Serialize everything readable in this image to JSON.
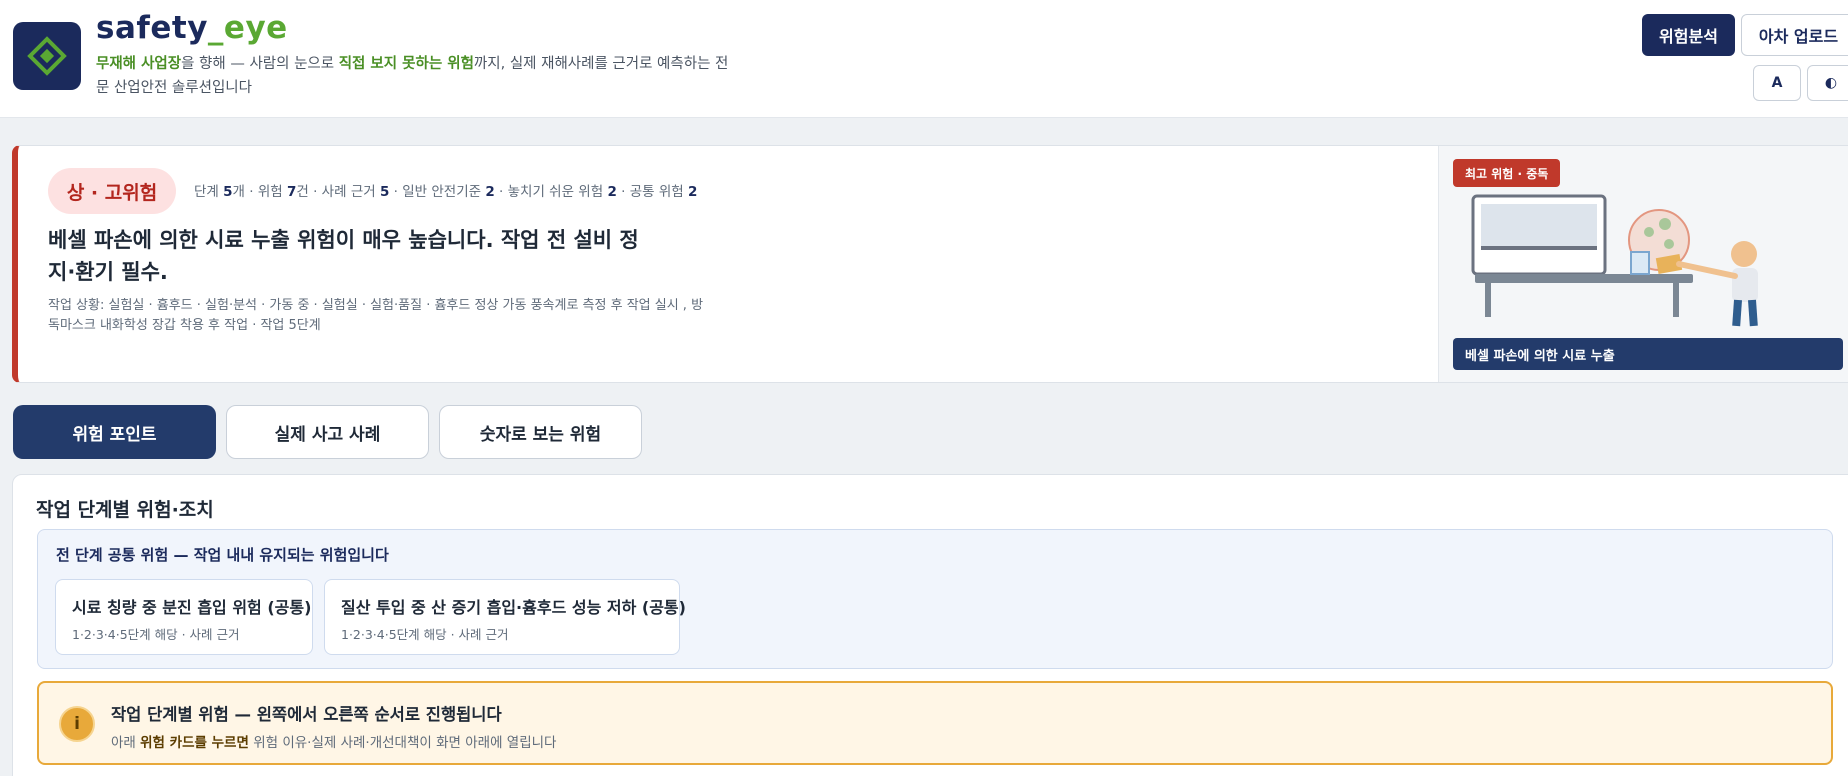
{
  "header": {
    "brand_main": "safety",
    "brand_accent": "_eye",
    "tagline_hl1": "무재해 사업장",
    "tagline_t1": "을 향해 — 사람의 눈으로 ",
    "tagline_hl2": "직접 보지 못하는 위험",
    "tagline_t2": "까지, 실제 재해사례를 근거로 예측하는 전문 산업안전 솔루션입니다",
    "btn_analyze": "위험분석",
    "btn_upload": "아차 업로드",
    "btn_font": "A",
    "btn_contrast": "◐"
  },
  "risk": {
    "level": "상 · 고위험",
    "stats": {
      "l1": "단계 ",
      "v1": "5",
      "l2": "개 · 위험 ",
      "v2": "7",
      "l3": "건 · 사례 근거 ",
      "v3": "5",
      "l4": " · 일반 안전기준 ",
      "v4": "2",
      "l5": " · 놓치기 쉬운 위험 ",
      "v5": "2",
      "l6": " · 공통 위험 ",
      "v6": "2"
    },
    "headline": "베셀 파손에 의한 시료 누출 위험이 매우 높습니다. 작업 전 설비 정지·환기 필수.",
    "detail": "작업 상황: 실험실 · 흄후드 · 실험·분석 · 가동 중 · 실험실 · 실험·품질 · 흄후드 정상 가동 풍속계로 측정 후 작업 실시 , 방독마스크 내화학성 장갑 착용 후 작업 · 작업 5단계",
    "illust_badge": "최고 위험 · 중독",
    "illust_caption": "베셀 파손에 의한 시료 누출"
  },
  "tabs": [
    "위험 포인트",
    "실제 사고 사례",
    "숫자로 보는 위험"
  ],
  "panel": {
    "title": "작업 단계별 위험·조치",
    "common_title": "전 단계 공통 위험 — 작업 내내 유지되는 위험입니다",
    "common_cards": [
      {
        "title": "시료 칭량 중 분진 흡입 위험 (공통)",
        "sub": "1·2·3·4·5단계 해당 · 사례 근거"
      },
      {
        "title": "질산 투입 중 산 증기 흡입·흄후드 성능 저하 (공통)",
        "sub": "1·2·3·4·5단계 해당 · 사례 근거"
      }
    ],
    "notice_icon": "i",
    "notice_title": "작업 단계별 위험 — 왼쪽에서 오른쪽 순서로 진행됩니다",
    "notice_t1": "아래 ",
    "notice_bold": "위험 카드를 누르면",
    "notice_t2": " 위험 이유·실제 사례·개선대책이 화면 아래에 열립니다"
  },
  "colors": {
    "navy": "#1b2a5c",
    "green": "#5aa833",
    "danger": "#c0392b",
    "warning": "#e8a93a"
  },
  "icons": {
    "logo": "diamond-logo-icon",
    "notice": "info-icon"
  }
}
